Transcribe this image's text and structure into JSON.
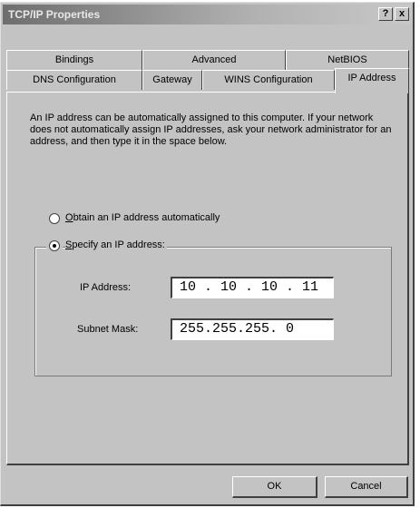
{
  "window": {
    "title": "TCP/IP Properties",
    "help_label": "?",
    "close_label": "x"
  },
  "tabs_row1": [
    "Bindings",
    "Advanced",
    "NetBIOS"
  ],
  "tabs_row2": [
    "DNS Configuration",
    "Gateway",
    "WINS Configuration",
    "IP Address"
  ],
  "active_tab": "IP Address",
  "description": "An IP address can be automatically assigned to this computer. If your network does not automatically assign IP addresses, ask your network administrator for an address, and then type it in the space below.",
  "radio_auto": {
    "label_mnemonic": "O",
    "label_rest": "btain an IP address automatically",
    "selected": false
  },
  "radio_specify": {
    "label_mnemonic": "S",
    "label_rest": "pecify an IP address:",
    "selected": true
  },
  "ip_address": {
    "label": "IP Address:",
    "value": "10 . 10 . 10 . 11"
  },
  "subnet_mask": {
    "label": "Subnet Mask:",
    "value": "255.255.255. 0"
  },
  "buttons": {
    "ok": "OK",
    "cancel": "Cancel"
  }
}
